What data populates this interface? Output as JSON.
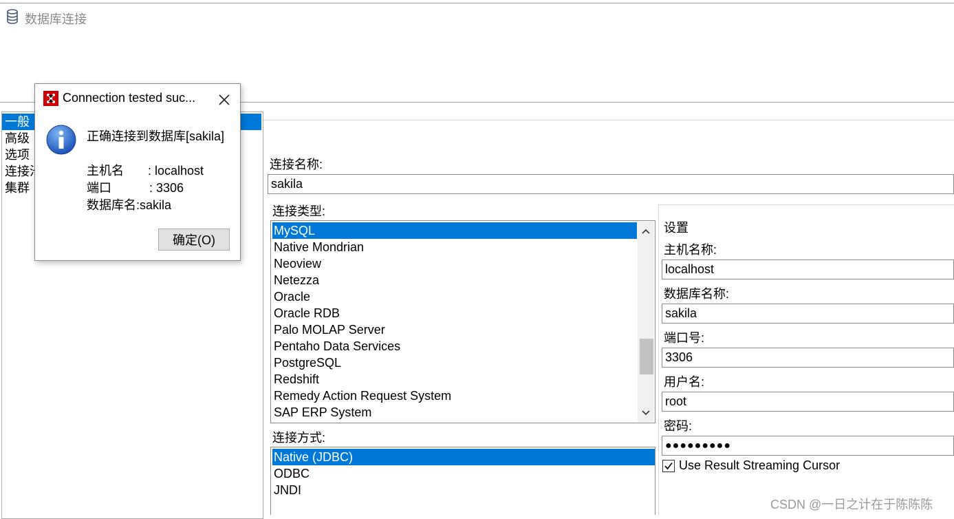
{
  "window": {
    "menu_fragment": "...",
    "title": "数据库连接"
  },
  "nav": {
    "items": [
      {
        "label": "一般",
        "selected": true
      },
      {
        "label": "高级",
        "selected": false
      },
      {
        "label": "选项",
        "selected": false
      },
      {
        "label": "连接池",
        "selected": false
      },
      {
        "label": "集群",
        "selected": false
      }
    ]
  },
  "form": {
    "connection_name_label": "连接名称:",
    "connection_name_value": "sakila",
    "connection_type_label": "连接类型:",
    "connection_types": [
      {
        "label": "MySQL",
        "selected": true
      },
      {
        "label": "Native Mondrian",
        "selected": false
      },
      {
        "label": "Neoview",
        "selected": false
      },
      {
        "label": "Netezza",
        "selected": false
      },
      {
        "label": "Oracle",
        "selected": false
      },
      {
        "label": "Oracle RDB",
        "selected": false
      },
      {
        "label": "Palo MOLAP Server",
        "selected": false
      },
      {
        "label": "Pentaho Data Services",
        "selected": false
      },
      {
        "label": "PostgreSQL",
        "selected": false
      },
      {
        "label": "Redshift",
        "selected": false
      },
      {
        "label": "Remedy Action Request System",
        "selected": false
      },
      {
        "label": "SAP ERP System",
        "selected": false
      }
    ],
    "access_label": "连接方式:",
    "access_methods": [
      {
        "label": "Native (JDBC)",
        "selected": true
      },
      {
        "label": "ODBC",
        "selected": false
      },
      {
        "label": "JNDI",
        "selected": false
      }
    ]
  },
  "settings": {
    "title": "设置",
    "host_label": "主机名称:",
    "host_value": "localhost",
    "db_label": "数据库名称:",
    "db_value": "sakila",
    "port_label": "端口号:",
    "port_value": "3306",
    "user_label": "用户名:",
    "user_value": "root",
    "password_label": "密码:",
    "password_value": "●●●●●●●●●",
    "streaming_label": "Use Result Streaming Cursor",
    "streaming_checked": true
  },
  "dialog": {
    "title": "Connection tested suc...",
    "message": "正确连接到数据库[sakila]",
    "host_line": "主机名       : localhost",
    "port_line": "端口           : 3306",
    "db_line": "数据库名:sakila",
    "ok_label": "确定(O)"
  },
  "watermark": "CSDN @一日之计在于陈陈陈",
  "colors": {
    "selection": "#0078d7",
    "dialog_icon_red": "#cc0000"
  }
}
